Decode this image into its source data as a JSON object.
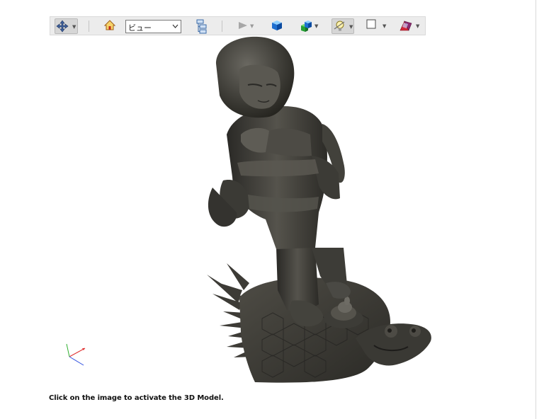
{
  "toolbar": {
    "buttons": [
      {
        "name": "rotate-tool",
        "icon": "move-arrows-icon",
        "has_dropdown": true,
        "active": true
      },
      {
        "name": "home",
        "icon": "home-icon"
      },
      {
        "name": "model-tree",
        "icon": "model-tree-icon"
      },
      {
        "name": "play-animation",
        "icon": "play-icon",
        "has_dropdown": true,
        "disabled": true
      },
      {
        "name": "render-mode",
        "icon": "blue-cube-icon"
      },
      {
        "name": "lighting-cubes",
        "icon": "cubes-icon",
        "has_dropdown": true
      },
      {
        "name": "lighting",
        "icon": "light-bulb-icon",
        "has_dropdown": true,
        "active": true
      },
      {
        "name": "background-color",
        "icon": "white-square-icon",
        "has_dropdown": true
      },
      {
        "name": "cross-section",
        "icon": "cross-section-icon",
        "has_dropdown": true
      }
    ],
    "view_select": {
      "value": "ビュー"
    }
  },
  "caption": "Click on the image to activate the 3D Model.",
  "colors": {
    "toolbar_bg": "#ececec",
    "statue_dark": "#2a2a28",
    "statue_mid": "#4a4944",
    "statue_light": "#6a6861",
    "axis_x": "#e03030",
    "axis_y": "#30b030",
    "axis_z": "#3050e0"
  }
}
